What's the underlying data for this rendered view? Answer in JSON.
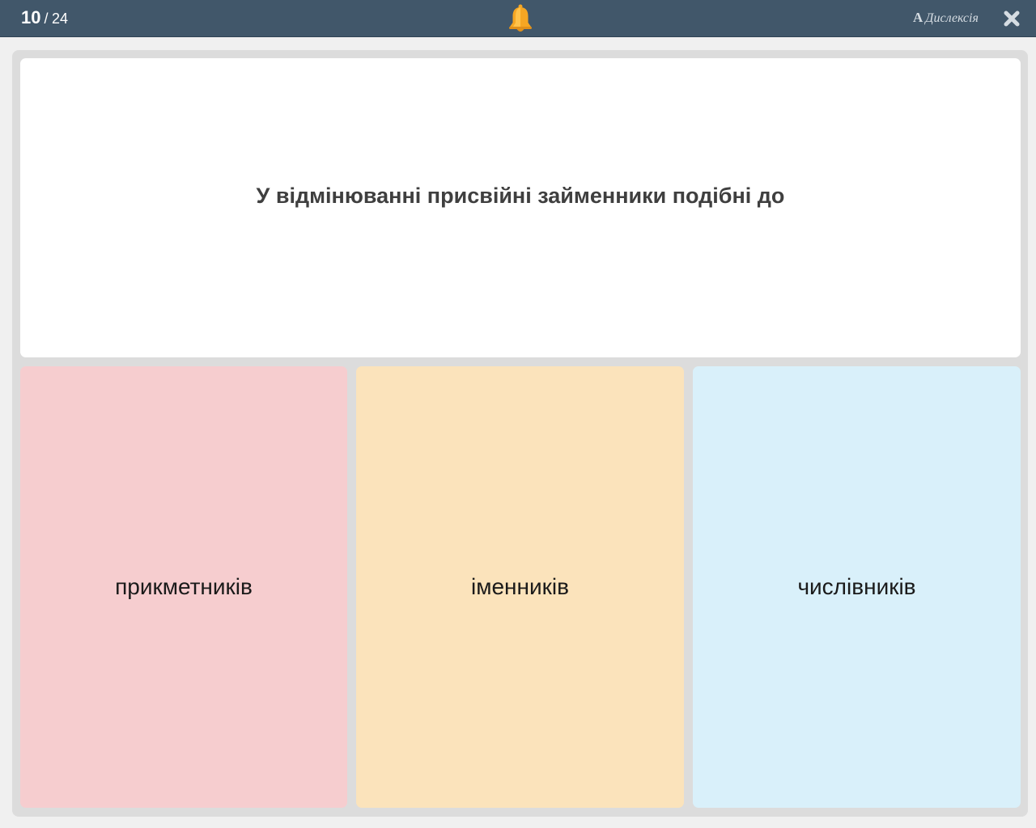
{
  "header": {
    "current_question": "10",
    "separator": "/",
    "total_questions": "24",
    "dyslexia_letter": "A",
    "dyslexia_label": "Дислексія",
    "bell_icon": "bell-icon",
    "close_icon": "close-icon"
  },
  "question": {
    "text": "У відмінюванні присвійні займенники подібні до"
  },
  "answers": [
    {
      "label": "прикметників",
      "color": "#f6cdcf"
    },
    {
      "label": "іменників",
      "color": "#fbe3bb"
    },
    {
      "label": "числівників",
      "color": "#d9f0fa"
    }
  ],
  "colors": {
    "topbar": "#41576a",
    "bell": "#f5a623",
    "panel": "#dcdcdc"
  }
}
